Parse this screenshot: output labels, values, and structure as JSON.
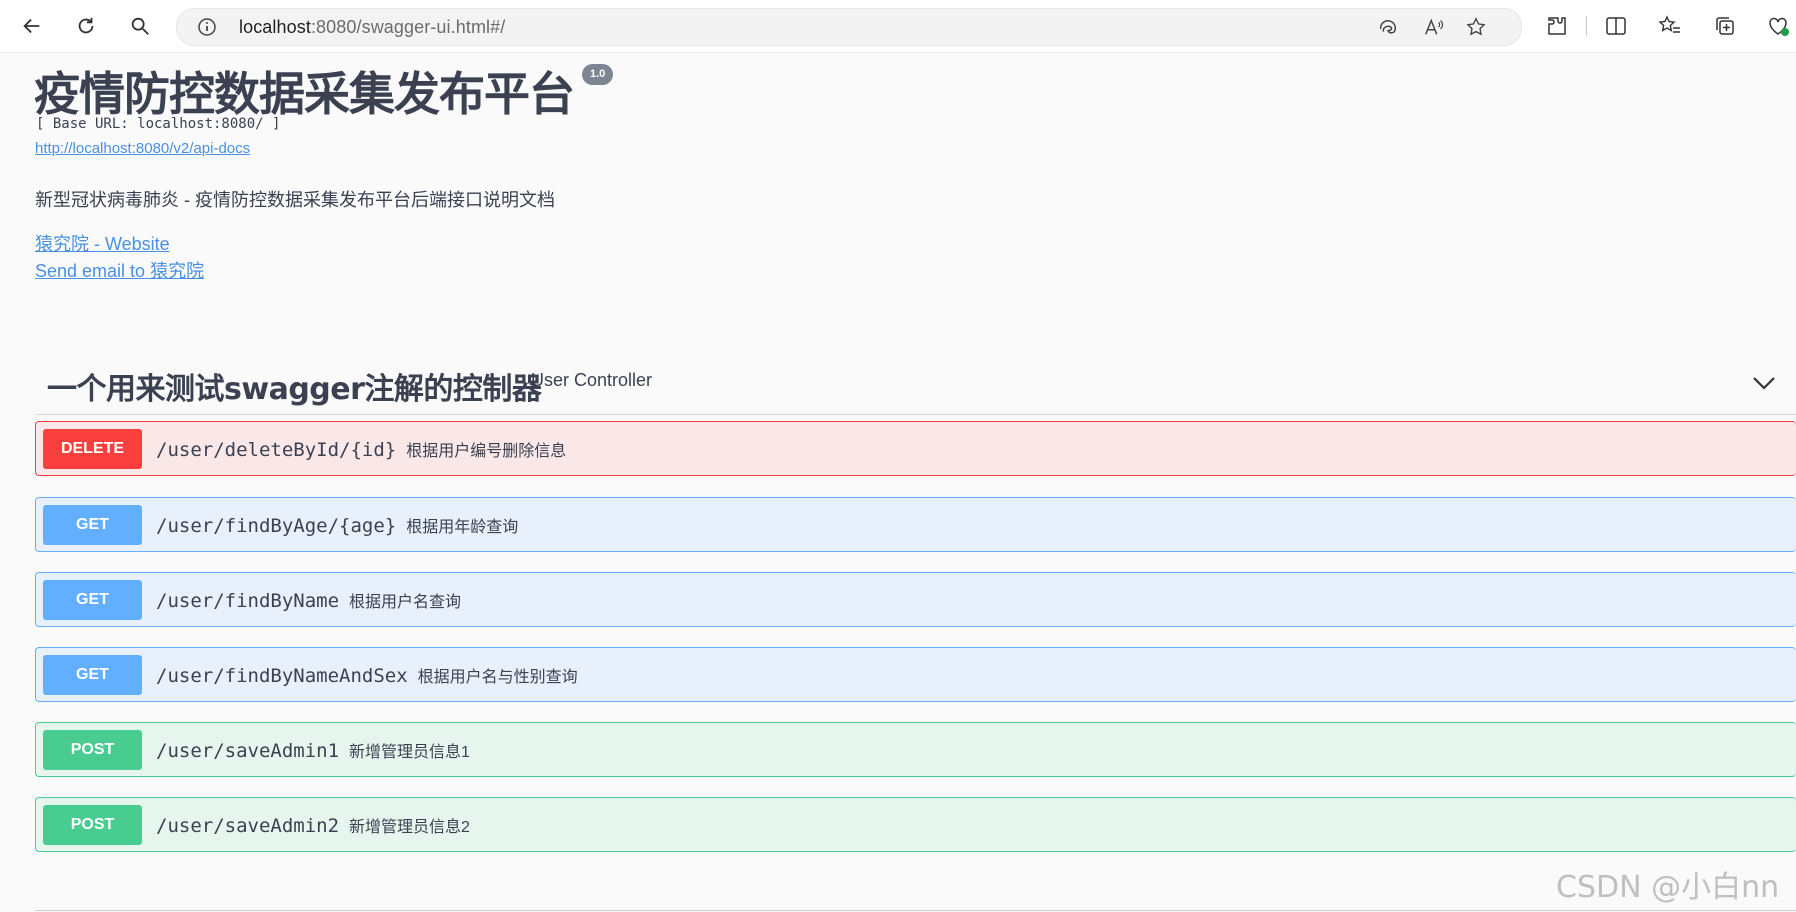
{
  "browser": {
    "url_host": "localhost",
    "url_path": ":8080/swagger-ui.html#/"
  },
  "info": {
    "title": "疫情防控数据采集发布平台",
    "version": "1.0",
    "base_url": "[ Base URL: localhost:8080/ ]",
    "api_docs_link": "http://localhost:8080/v2/api-docs",
    "description": "新型冠状病毒肺炎 - 疫情防控数据采集发布平台后端接口说明文档",
    "website_link": "猿究院 - Website",
    "email_link": "Send email to 猿究院"
  },
  "tag": {
    "title": "一个用来测试swagger注解的控制器",
    "description": "User Controller"
  },
  "operations": [
    {
      "method": "DELETE",
      "path": "/user/deleteById/{id}",
      "summary": "根据用户编号删除信息"
    },
    {
      "method": "GET",
      "path": "/user/findByAge/{age}",
      "summary": "根据用年龄查询"
    },
    {
      "method": "GET",
      "path": "/user/findByName",
      "summary": "根据用户名查询"
    },
    {
      "method": "GET",
      "path": "/user/findByNameAndSex",
      "summary": "根据用户名与性别查询"
    },
    {
      "method": "POST",
      "path": "/user/saveAdmin1",
      "summary": "新增管理员信息1"
    },
    {
      "method": "POST",
      "path": "/user/saveAdmin2",
      "summary": "新增管理员信息2"
    }
  ],
  "watermark": "CSDN @小白nn",
  "colors": {
    "delete": "#f93e3e",
    "get": "#61affe",
    "post": "#49cc90",
    "link": "#4990e2"
  }
}
